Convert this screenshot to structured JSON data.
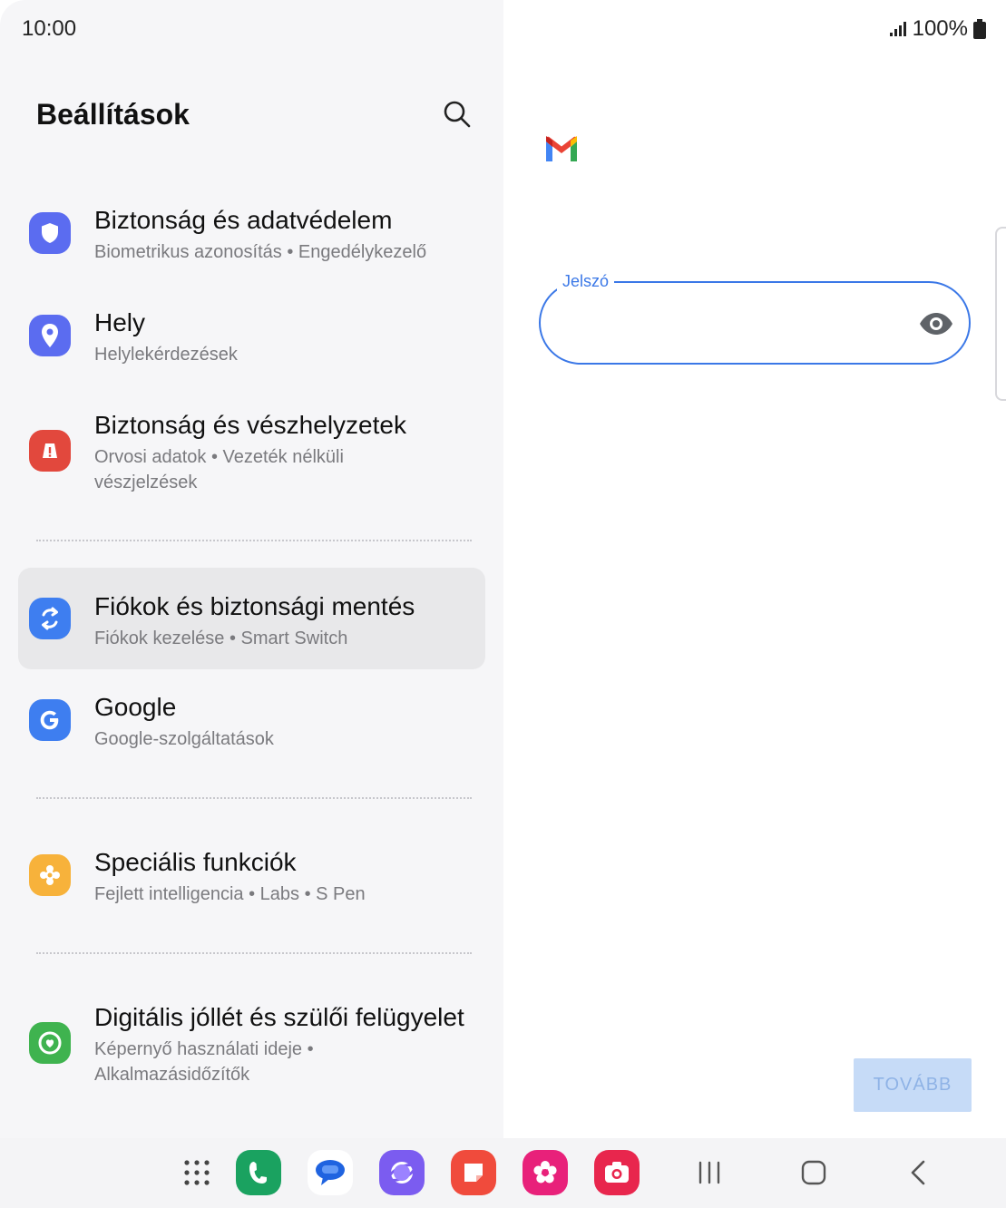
{
  "status": {
    "time": "10:00",
    "battery": "100%"
  },
  "settings": {
    "title": "Beállítások",
    "items": [
      {
        "title": "Biztonság és adatvédelem",
        "subtitle": "Biometrikus azonosítás  •  Engedélykezelő",
        "icon": "shield-icon",
        "color": "#5b6cf0"
      },
      {
        "title": "Hely",
        "subtitle": "Helylekérdezések",
        "icon": "location-pin-icon",
        "color": "#5b6cf0"
      },
      {
        "title": "Biztonság és vészhelyzetek",
        "subtitle": "Orvosi adatok  •  Vezeték nélküli vészjelzések",
        "icon": "emergency-icon",
        "color": "#e2483d"
      },
      {
        "title": "Fiókok és biztonsági mentés",
        "subtitle": "Fiókok kezelése  •  Smart Switch",
        "icon": "sync-icon",
        "color": "#3e7ef0"
      },
      {
        "title": "Google",
        "subtitle": "Google-szolgáltatások",
        "icon": "google-g-icon",
        "color": "#3e7ef0"
      },
      {
        "title": "Speciális funkciók",
        "subtitle": "Fejlett intelligencia  •  Labs  •  S Pen",
        "icon": "gear-flower-icon",
        "color": "#f7b23b"
      },
      {
        "title": "Digitális jóllét és szülői felügyelet",
        "subtitle": "Képernyő használati ideje  •  Alkalmazásidőzítők",
        "icon": "wellbeing-heart-icon",
        "color": "#3fb34f"
      }
    ]
  },
  "gmail": {
    "password_label": "Jelszó",
    "password_value": "",
    "next_label": "TOVÁBB"
  },
  "taskbar": {
    "apps": [
      "apps-grid-icon",
      "phone-icon",
      "messages-icon",
      "internet-icon",
      "notes-icon",
      "gallery-icon",
      "camera-icon"
    ],
    "nav": [
      "recents-icon",
      "home-icon",
      "back-icon"
    ]
  }
}
